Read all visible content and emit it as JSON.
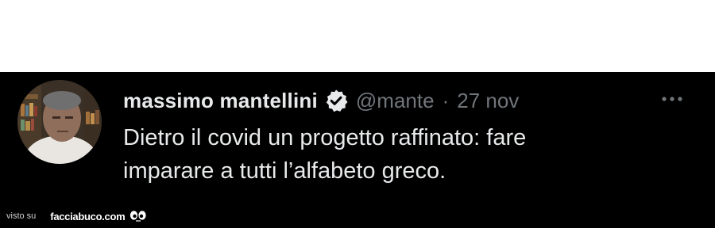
{
  "tweet": {
    "author_name": "massimo mantellini",
    "handle": "@mante",
    "separator": "·",
    "date": "27 nov",
    "text_line_1": "Dietro il covid un progetto raffinato: fare",
    "text_line_2": "imparare a tutti l’alfabeto greco.",
    "verified_icon": "verified-badge-icon",
    "more_icon": "more-options-icon"
  },
  "watermark": {
    "prefix": "visto su",
    "site": "facciabuco.com",
    "logo_icon": "googly-eyes-icon"
  },
  "colors": {
    "background": "#000000",
    "top_area": "#ffffff",
    "primary_text": "#e7e9ea",
    "secondary_text": "#71767b"
  }
}
